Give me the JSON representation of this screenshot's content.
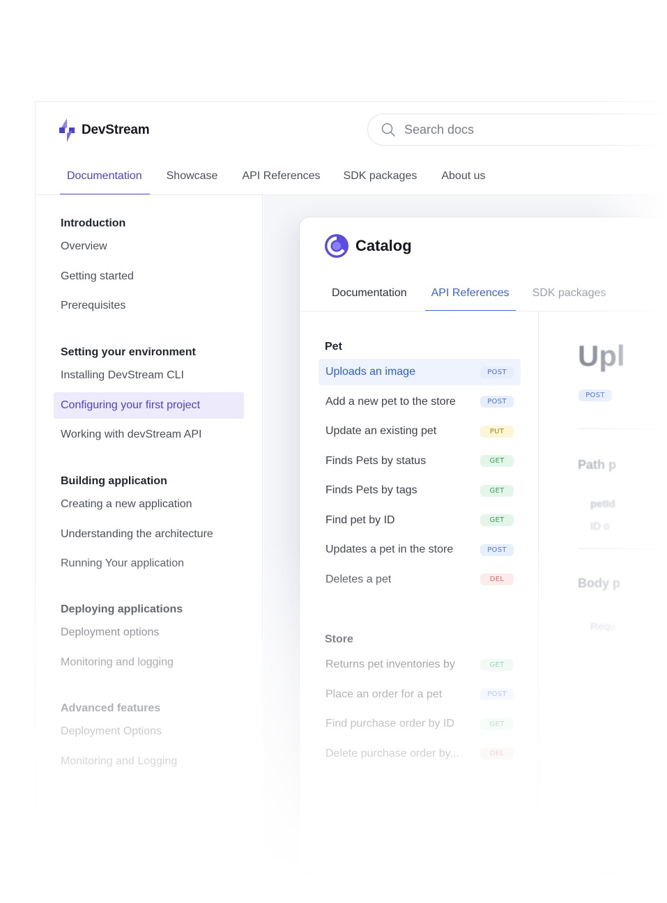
{
  "app": {
    "name": "DevStream",
    "search_placeholder": "Search docs",
    "nav": [
      {
        "label": "Documentation",
        "active": true
      },
      {
        "label": "Showcase"
      },
      {
        "label": "API References"
      },
      {
        "label": "SDK packages"
      },
      {
        "label": "About us"
      }
    ],
    "accent": "#5040d0"
  },
  "sidebar": {
    "groups": [
      {
        "title": "Introduction",
        "items": [
          "Overview",
          "Getting started",
          "Prerequisites"
        ]
      },
      {
        "title": "Setting your environment",
        "items": [
          "Installing DevStream CLI",
          "Configuring your first project",
          "Working with devStream API"
        ],
        "active_item": "Configuring your first project"
      },
      {
        "title": "Building application",
        "items": [
          "Creating a new application",
          "Understanding the architecture",
          "Running Your application"
        ]
      },
      {
        "title": "Deploying applications",
        "items": [
          "Deployment options",
          "Monitoring and logging"
        ]
      },
      {
        "title": "Advanced features",
        "items": [
          "Deployment Options",
          "Monitoring and Logging"
        ]
      }
    ]
  },
  "catalog": {
    "title": "Catalog",
    "tabs": [
      {
        "label": "Documentation"
      },
      {
        "label": "API References",
        "active": true
      },
      {
        "label": "SDK packages"
      }
    ],
    "sections": [
      {
        "title": "Pet",
        "endpoints": [
          {
            "label": "Uploads an image",
            "method": "POST",
            "active": true
          },
          {
            "label": "Add a new pet to the store",
            "method": "POST"
          },
          {
            "label": "Update an existing pet",
            "method": "PUT"
          },
          {
            "label": "Finds Pets by status",
            "method": "GET"
          },
          {
            "label": "Finds Pets by tags",
            "method": "GET"
          },
          {
            "label": "Find pet by ID",
            "method": "GET"
          },
          {
            "label": "Updates a pet in the store",
            "method": "POST"
          },
          {
            "label": "Deletes a pet",
            "method": "DEL"
          }
        ]
      },
      {
        "title": "Store",
        "endpoints": [
          {
            "label": "Returns pet inventories by",
            "method": "GET"
          },
          {
            "label": "Place an order for a pet",
            "method": "POST"
          },
          {
            "label": "Find purchase order by ID",
            "method": "GET"
          },
          {
            "label": "Delete purchase order by...",
            "method": "DEL"
          }
        ]
      }
    ],
    "detail": {
      "title": "Upl",
      "method": "POST",
      "path_heading": "Path p",
      "param_name": "petId",
      "param_desc": "ID o",
      "body_heading": "Body p",
      "body_text": "Requ"
    }
  }
}
